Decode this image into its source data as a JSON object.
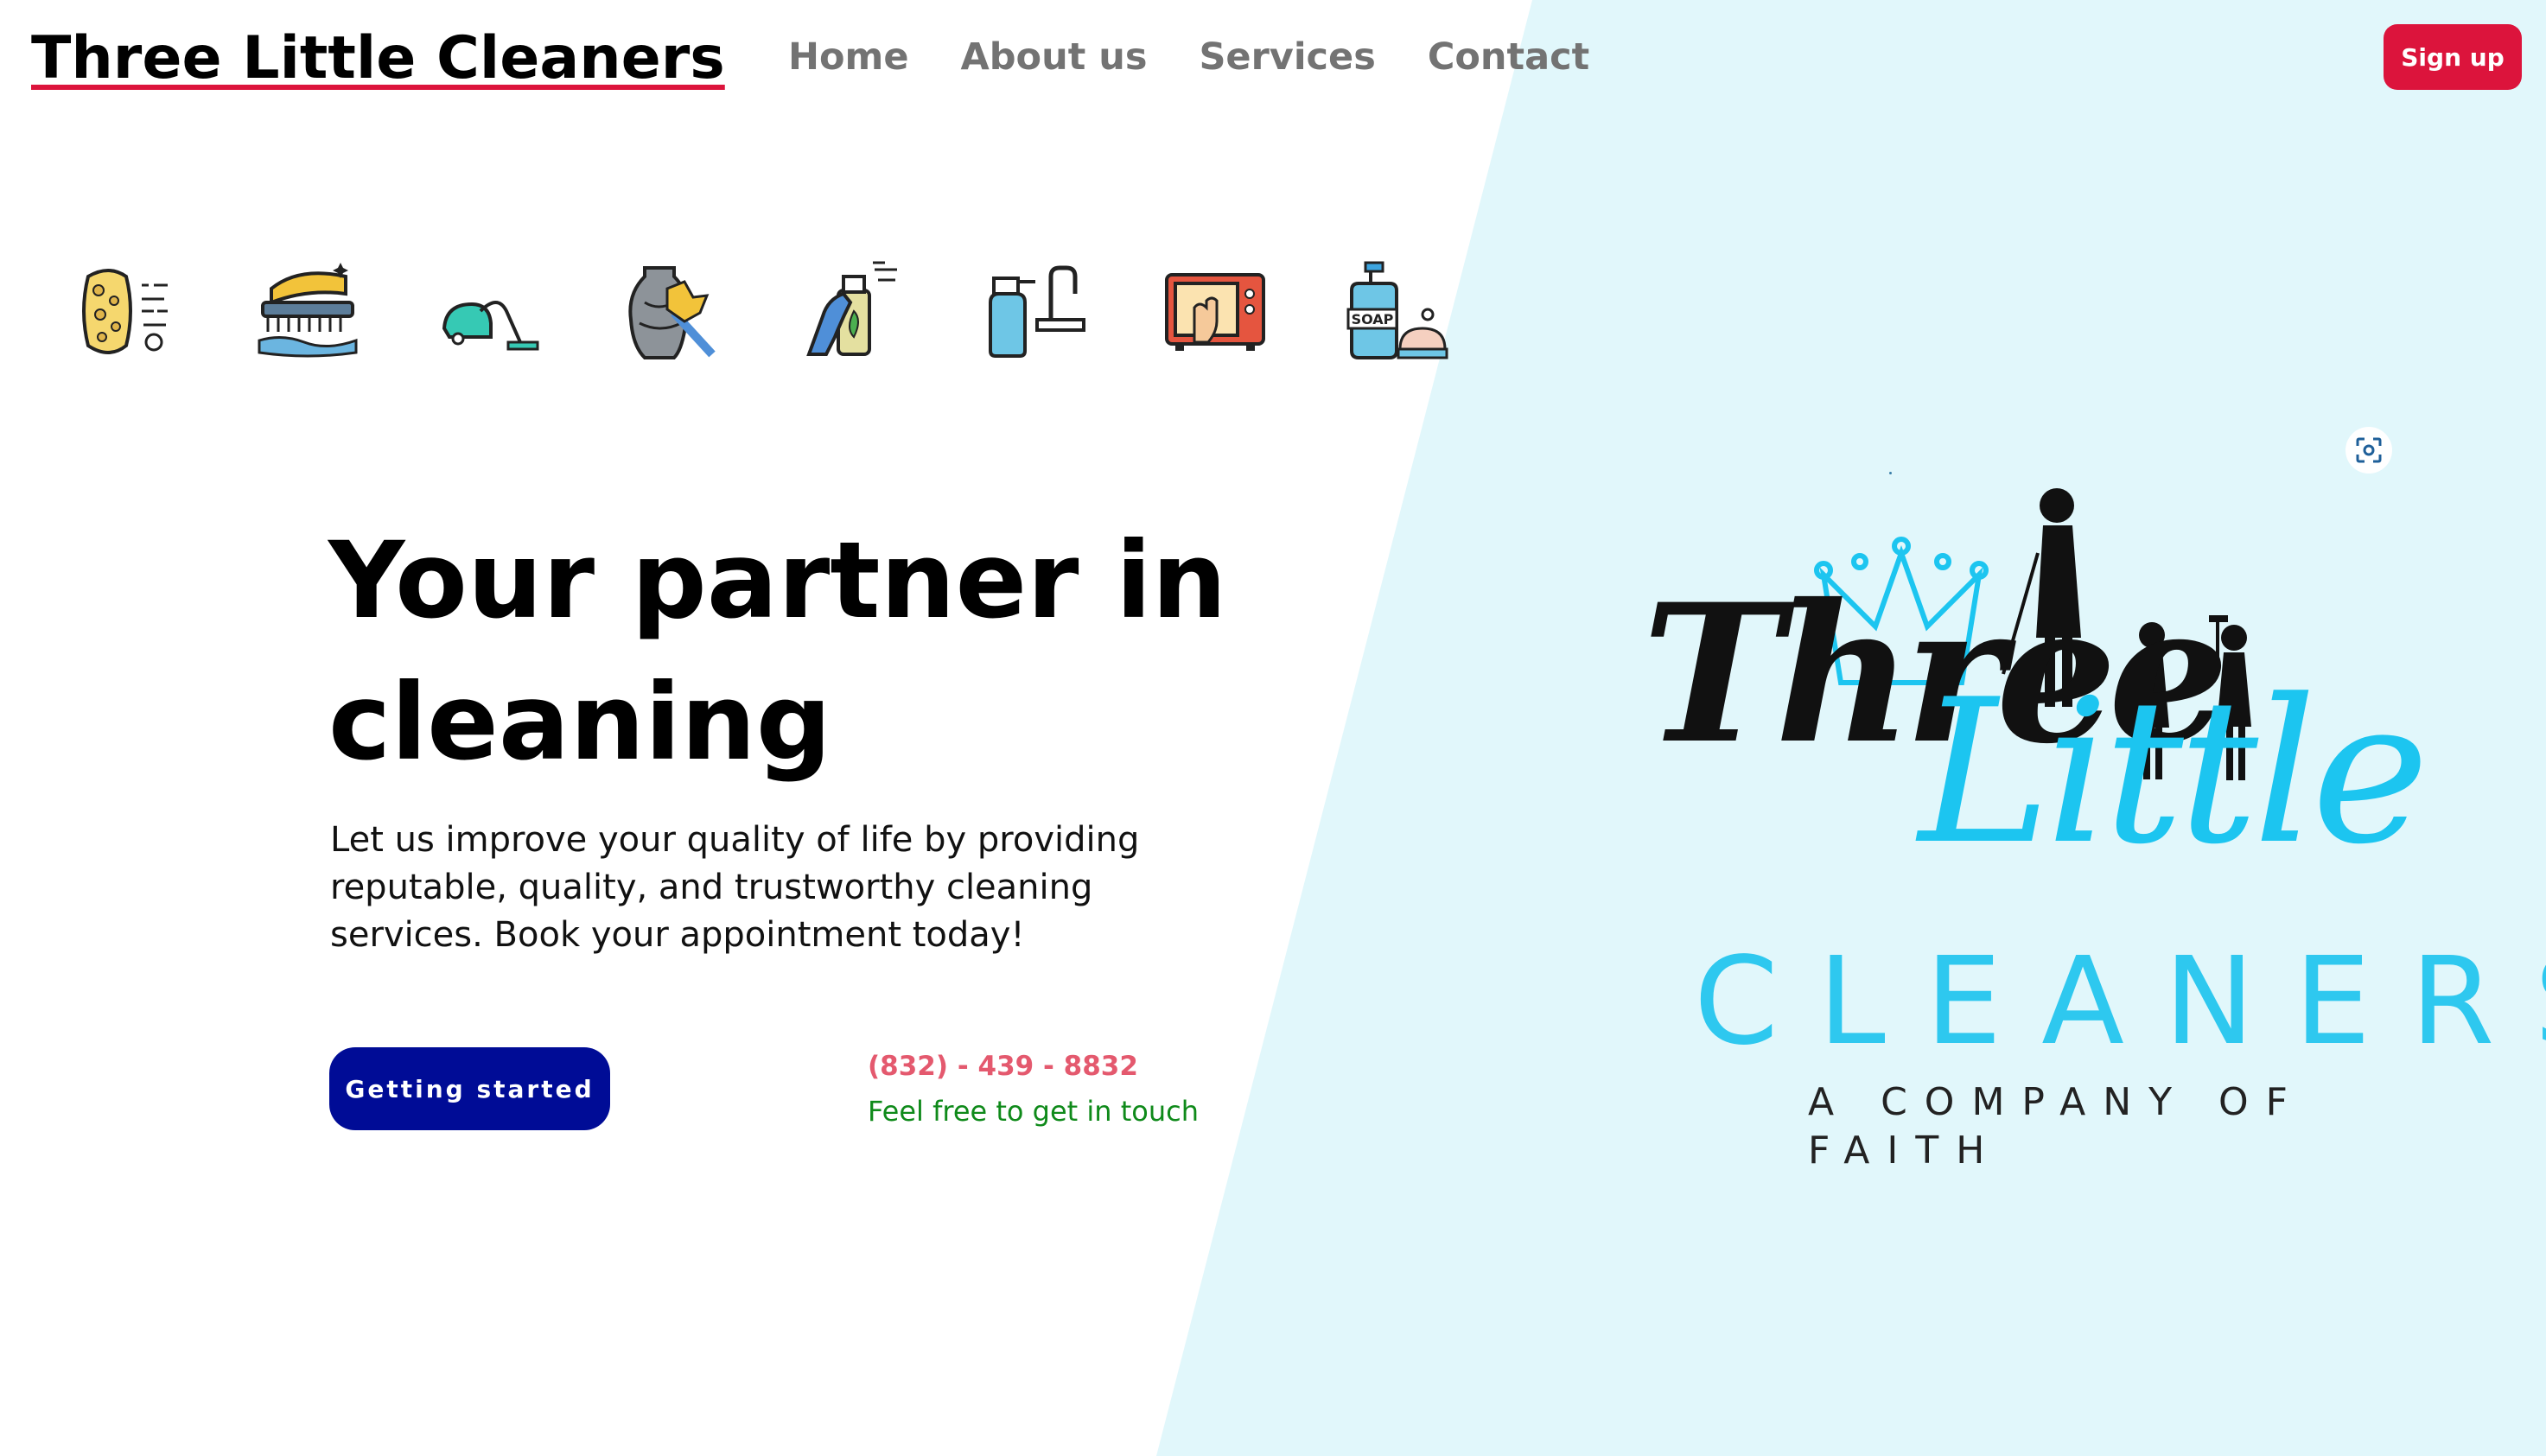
{
  "header": {
    "brand": "Three Little Cleaners",
    "nav": [
      {
        "label": "Home"
      },
      {
        "label": "About us"
      },
      {
        "label": "Services"
      },
      {
        "label": "Contact"
      }
    ],
    "signup_label": "Sign up"
  },
  "services_icons": [
    "sponge-icon",
    "scrub-brush-icon",
    "vacuum-cleaner-icon",
    "vase-duster-icon",
    "spray-bottle-hand-icon",
    "faucet-spray-icon",
    "microwave-cleaning-icon",
    "soap-dispenser-icon"
  ],
  "soap_label": "SOAP",
  "hero": {
    "title": "Your partner in cleaning",
    "text": "Let us improve your quality of life by providing reputable, quality, and trustworthy cleaning services. Book your appointment today!",
    "cta_label": "Getting started"
  },
  "contact": {
    "phone": "(832) - 439 - 8832",
    "tagline": "Feel free to get in touch"
  },
  "logo": {
    "word1": "Three",
    "word2": "Little",
    "word3": "CLEANERS",
    "tagline": "A COMPANY OF FAITH"
  },
  "colors": {
    "accent_red": "#dc143c",
    "cta_blue": "#000c96",
    "panel_bg": "#e1f7fb",
    "phone_pink": "#e4596e",
    "tagline_green": "#0f8a1a",
    "logo_cyan": "#1cc5f0"
  }
}
